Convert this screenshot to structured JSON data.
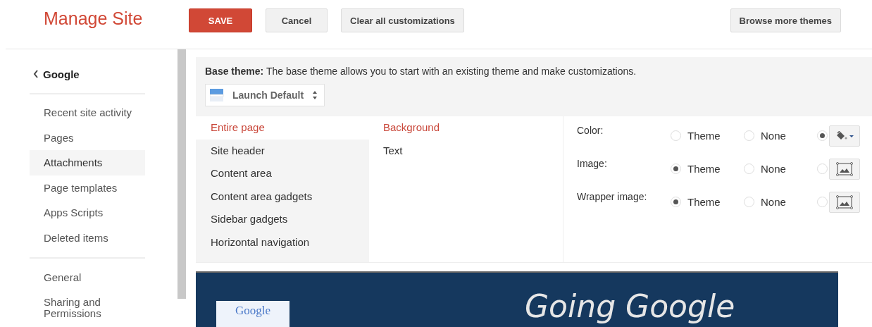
{
  "header": {
    "title": "Manage Site",
    "buttons": [
      {
        "label": "SAVE",
        "kind": "primary"
      },
      {
        "label": "Cancel",
        "kind": "default"
      },
      {
        "label": "Clear all customizations",
        "kind": "default"
      }
    ],
    "browse_button": "Browse more themes"
  },
  "sidebar": {
    "back_label": "Google",
    "groups": [
      {
        "items": [
          {
            "label": "Recent site activity",
            "selected": false
          },
          {
            "label": "Pages",
            "selected": false
          },
          {
            "label": "Attachments",
            "selected": true
          },
          {
            "label": "Page templates",
            "selected": false
          },
          {
            "label": "Apps Scripts",
            "selected": false
          },
          {
            "label": "Deleted items",
            "selected": false
          }
        ]
      },
      {
        "items": [
          {
            "label": "General",
            "selected": false
          },
          {
            "label": "Sharing and Permissions",
            "selected": false
          }
        ]
      }
    ]
  },
  "base_theme": {
    "description": "**Base theme:** The base theme allows you to start with an existing theme and make customizations.",
    "select_value": "Launch Default"
  },
  "sections": [
    {
      "label": "Entire page",
      "selected": true
    },
    {
      "label": "Site header",
      "selected": false
    },
    {
      "label": "Content area",
      "selected": false
    },
    {
      "label": "Content area gadgets",
      "selected": false
    },
    {
      "label": "Sidebar gadgets",
      "selected": false
    },
    {
      "label": "Horizontal navigation",
      "selected": false
    }
  ],
  "properties": [
    {
      "label": "Background",
      "selected": true
    },
    {
      "label": "Text",
      "selected": false
    }
  ],
  "settings": [
    {
      "label": "Color:",
      "kind": "color",
      "options": [
        {
          "kind": "labeled",
          "label": "Theme",
          "selected": false
        },
        {
          "kind": "labeled",
          "label": "None",
          "selected": false
        },
        {
          "kind": "custom",
          "selected": true
        }
      ]
    },
    {
      "label": "Image:",
      "kind": "image",
      "options": [
        {
          "kind": "labeled",
          "label": "Theme",
          "selected": true
        },
        {
          "kind": "labeled",
          "label": "None",
          "selected": false
        },
        {
          "kind": "custom",
          "selected": false
        }
      ]
    },
    {
      "label": "Wrapper image:",
      "kind": "image",
      "options": [
        {
          "kind": "labeled",
          "label": "Theme",
          "selected": true
        },
        {
          "kind": "labeled",
          "label": "None",
          "selected": false
        },
        {
          "kind": "custom",
          "selected": false
        }
      ]
    }
  ],
  "preview": {
    "logo_text": "Google",
    "title": "Going Google"
  }
}
